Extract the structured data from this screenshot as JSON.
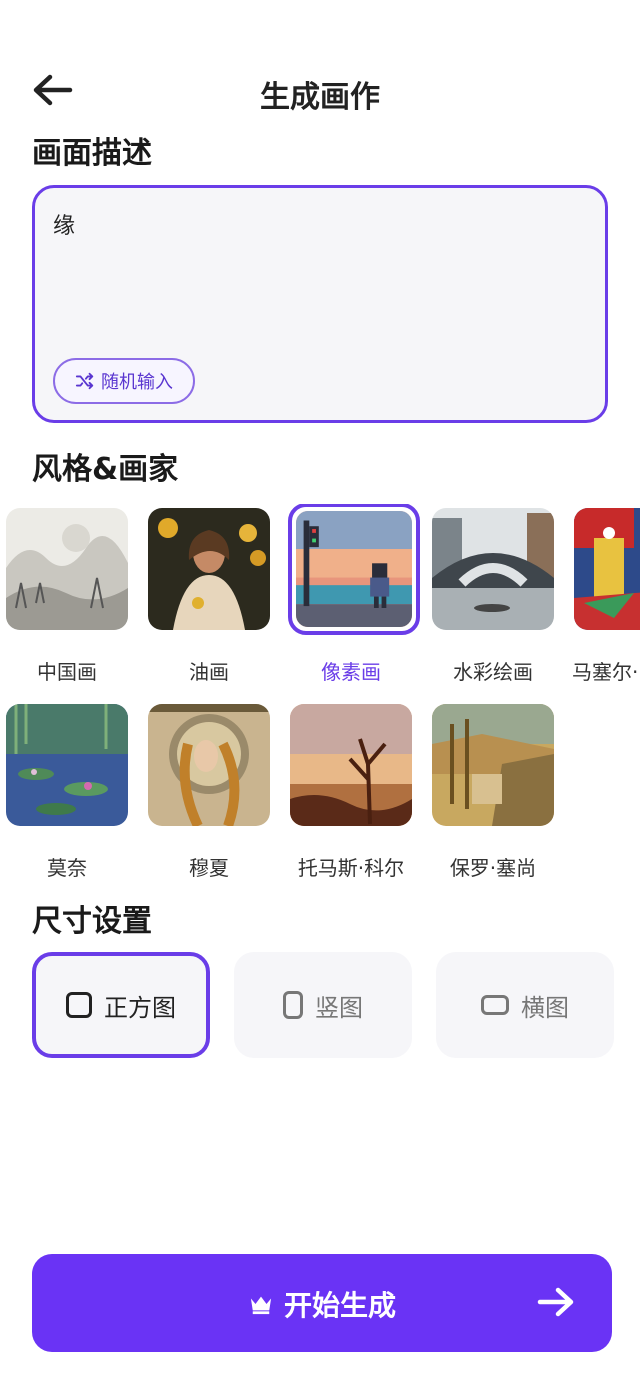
{
  "header": {
    "title": "生成画作",
    "back_icon": "arrow-left-icon"
  },
  "description": {
    "section_title": "画面描述",
    "value": "缘",
    "random_label": "随机输入",
    "random_icon": "shuffle-icon"
  },
  "styles": {
    "section_title": "风格&画家",
    "selected": "像素画",
    "items": [
      {
        "label": "中国画"
      },
      {
        "label": "油画"
      },
      {
        "label": "像素画"
      },
      {
        "label": "水彩绘画"
      },
      {
        "label": "马塞尔·"
      },
      {
        "label": "莫奈"
      },
      {
        "label": "穆夏"
      },
      {
        "label": "托马斯·科尔"
      },
      {
        "label": "保罗·塞尚"
      }
    ]
  },
  "size": {
    "section_title": "尺寸设置",
    "selected": "正方图",
    "options": [
      {
        "label": "正方图"
      },
      {
        "label": "竖图"
      },
      {
        "label": "横图"
      }
    ]
  },
  "start": {
    "label": "开始生成",
    "icon": "crown-icon",
    "arrow_icon": "arrow-right-icon"
  },
  "colors": {
    "accent": "#6a3de8",
    "button": "#6a33f5",
    "card_bg": "#f6f6f9"
  }
}
